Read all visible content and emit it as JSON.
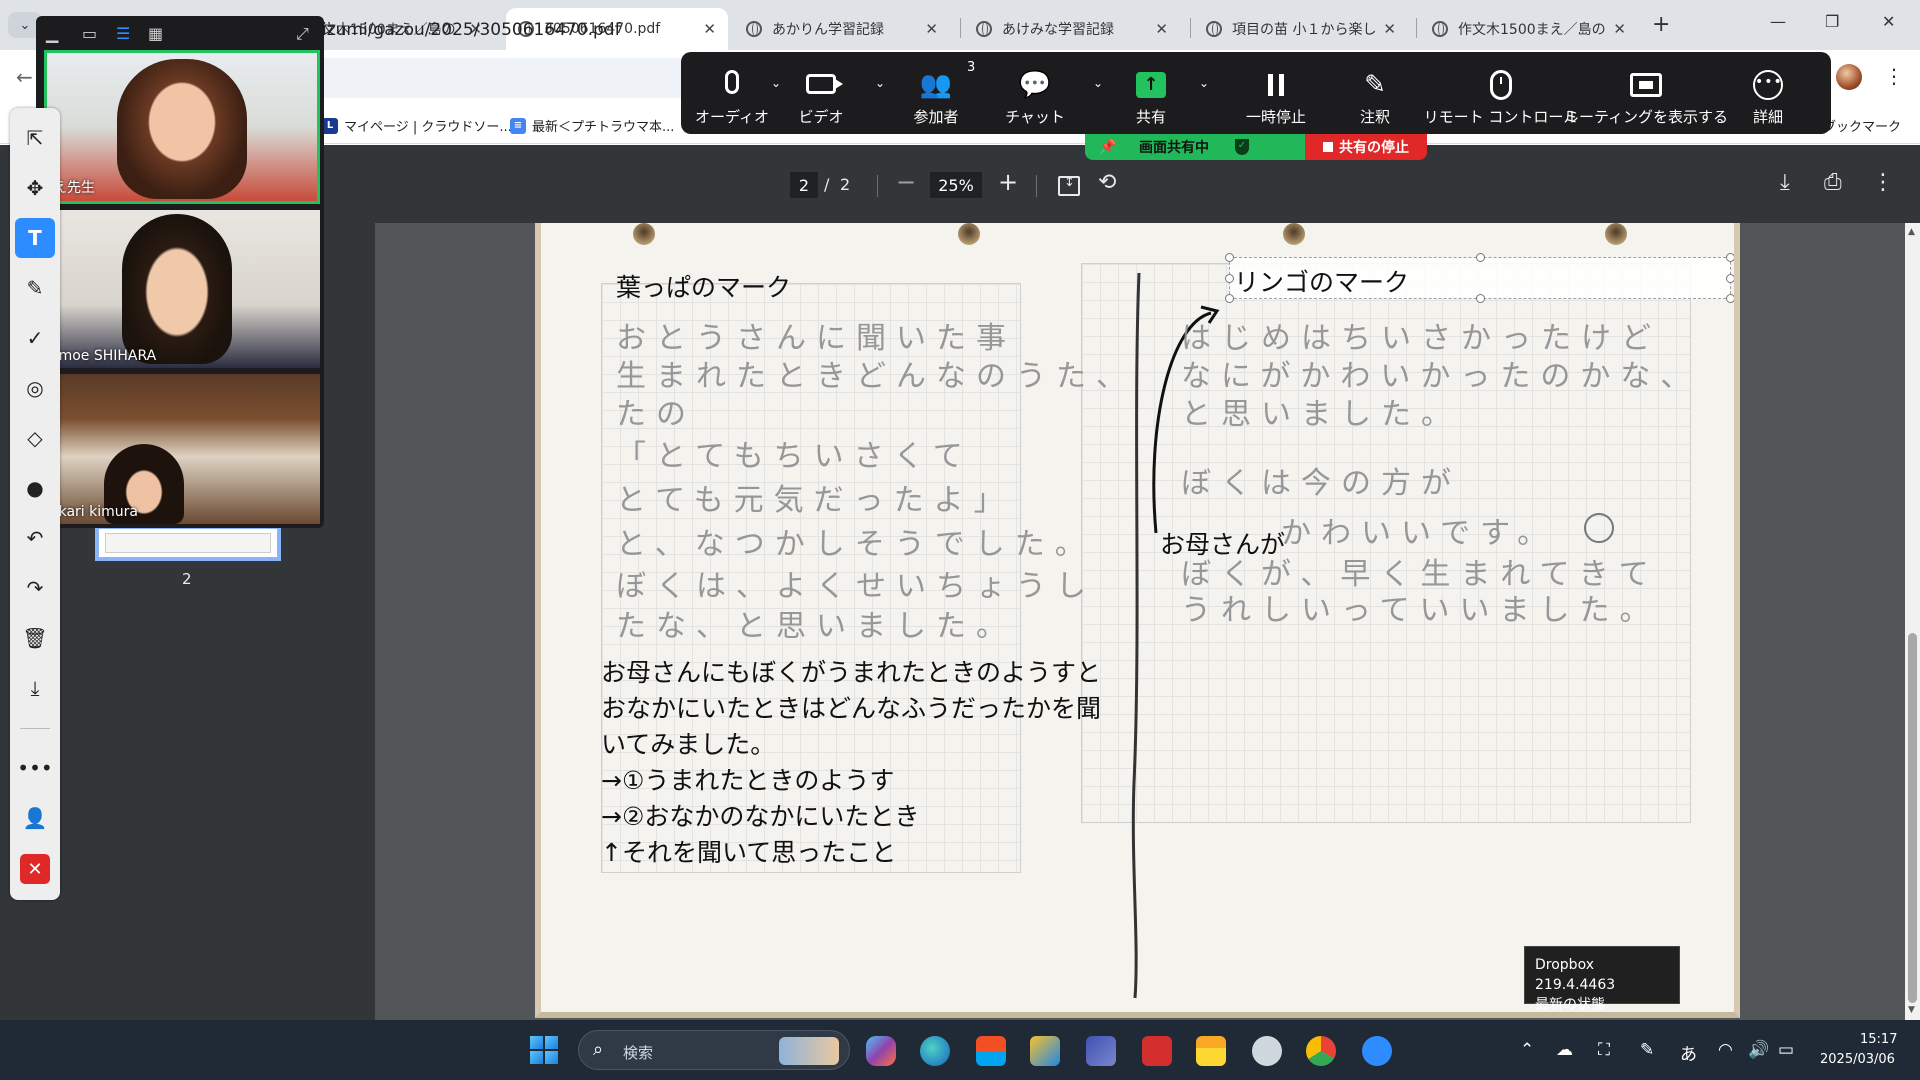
{
  "browser": {
    "tabs": [
      {
        "label": "作文木1500まえ／島の",
        "active": false
      },
      {
        "label": "3050616470.pdf",
        "active": true
      },
      {
        "label": "あかりん学習記録",
        "active": false
      },
      {
        "label": "あけみな学習記録",
        "active": false
      },
      {
        "label": "項目の苗 小１から楽し",
        "active": false
      },
      {
        "label": "作文木1500まえ／島の",
        "active": false
      }
    ],
    "tab_close_glyph": "✕",
    "new_tab_glyph": "+",
    "url": "izumi/gazou/2025/3050616470.pdf",
    "bookmarks": [
      {
        "label": "マイページ | クラウドソー...",
        "icon_letter": "L",
        "icon_color": "#1a3a8f"
      },
      {
        "label": "最新＜プチトラウマ本...",
        "icon_letter": "≡",
        "icon_color": "#4285f4"
      },
      {
        "label": "のブックマーク",
        "icon_letter": "",
        "icon_color": ""
      }
    ]
  },
  "pdf": {
    "page_current": "2",
    "page_separator": "/",
    "page_total": "2",
    "zoom": "25%",
    "thumbnail_number": "2"
  },
  "document": {
    "left_title": "葉っぱのマーク",
    "right_title": "リンゴのマーク",
    "mother_label": "お母さんが",
    "left_handwriting": [
      "おとうさんに聞いた事",
      "生まれたときどんなのうた、",
      "たの",
      "「とてもちいさくて",
      "とても元気だったよ」",
      "と、なつかしそうでした。",
      "ぼくは、よくせいちょうし",
      "たな、と思いました。"
    ],
    "right_handwriting": [
      "はじめはちいさかったけど",
      "なにがかわいかったのかな、",
      "と思いました。",
      "ぼくは今の方が",
      "かわいいです。",
      "ぼくが、早く生まれてきて",
      "うれしいっていいました。"
    ],
    "notes": [
      "お母さんにもぼくがうまれたときのようすと",
      "おなかにいたときはどんなふうだったかを聞",
      "いてみました。",
      "→①うまれたときのようす",
      "→②おなかのなかにいたとき",
      "↑それを聞いて思ったこと"
    ]
  },
  "meeting": {
    "buttons": [
      {
        "label": "オーディオ",
        "icon": "microphone-icon"
      },
      {
        "label": "ビデオ",
        "icon": "video-camera-icon"
      },
      {
        "label": "参加者",
        "icon": "participants-icon"
      },
      {
        "label": "チャット",
        "icon": "chat-icon"
      },
      {
        "label": "共有",
        "icon": "share-screen-icon"
      },
      {
        "label": "一時停止",
        "icon": "pause-icon"
      },
      {
        "label": "注釈",
        "icon": "pencil-icon"
      },
      {
        "label": "リモート コントロール",
        "icon": "mouse-icon"
      },
      {
        "label": "ミーティングを表示する",
        "icon": "show-meeting-icon"
      },
      {
        "label": "詳細",
        "icon": "more-icon"
      }
    ],
    "participant_count": "3",
    "sharing_status": "画面共有中",
    "stop_share": "共有の停止",
    "colors": {
      "share_green": "#21b859",
      "stop_red": "#e02828",
      "accent_blue": "#2d8cff"
    },
    "participants": [
      {
        "name": "え先生",
        "speaking": true
      },
      {
        "name": "omoe SHIHARA",
        "speaking": false
      },
      {
        "name": "akari kimura",
        "speaking": false
      }
    ]
  },
  "annotation_tools": [
    "select-icon",
    "move-icon",
    "text-icon",
    "pen-icon",
    "stamp-check-icon",
    "spotlight-icon",
    "eraser-icon",
    "color-icon",
    "undo-icon",
    "redo-icon",
    "trash-icon",
    "save-icon",
    "more-icon",
    "user-icon",
    "close-icon"
  ],
  "dropbox_tooltip": {
    "line1": "Dropbox 219.4.4463",
    "line2": "最新の状態"
  },
  "taskbar": {
    "search_label": "検索",
    "ime": "あ",
    "time": "15:17",
    "date": "2025/03/06"
  }
}
